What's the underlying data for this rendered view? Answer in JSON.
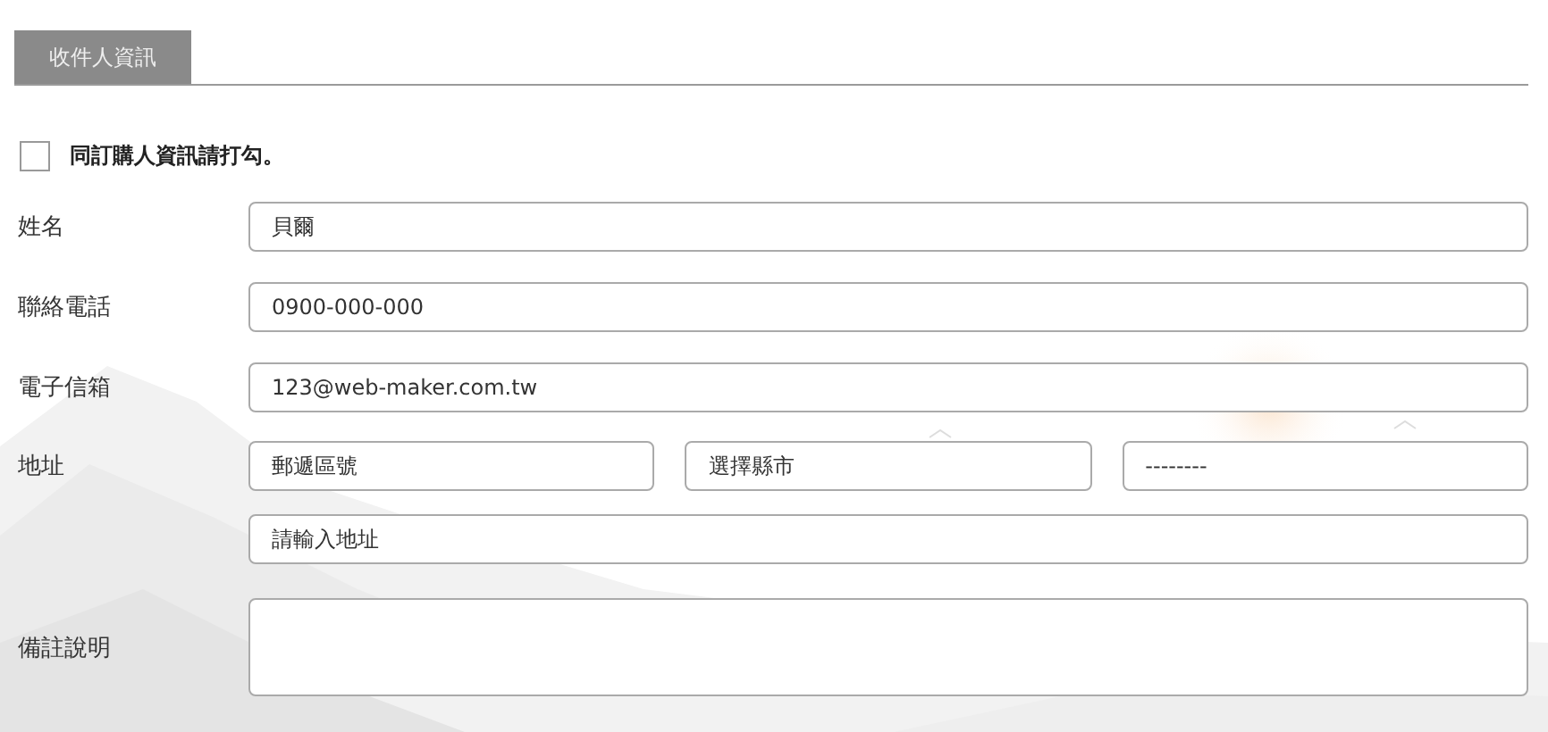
{
  "tabs": [
    {
      "label": "收件人資訊",
      "selected": true
    }
  ],
  "same_as_buyer": {
    "label": "同訂購人資訊請打勾。",
    "checked": false
  },
  "fields": [
    {
      "label": "姓名",
      "inputs": [
        {
          "value": "貝爾"
        }
      ]
    },
    {
      "label": "聯絡電話",
      "inputs": [
        {
          "value": "0900-000-000"
        }
      ]
    },
    {
      "label": "電子信箱",
      "inputs": [
        {
          "value": "123@web-maker.com.tw"
        }
      ]
    },
    {
      "label": "地址",
      "inputs": [
        {
          "placeholder": "郵遞區號"
        },
        {
          "value": "選擇縣市"
        },
        {
          "value": "--------"
        }
      ]
    },
    {
      "inputs": [
        {
          "placeholder": "請輸入地址"
        }
      ]
    }
  ],
  "notes": {
    "label": "備註說明"
  }
}
